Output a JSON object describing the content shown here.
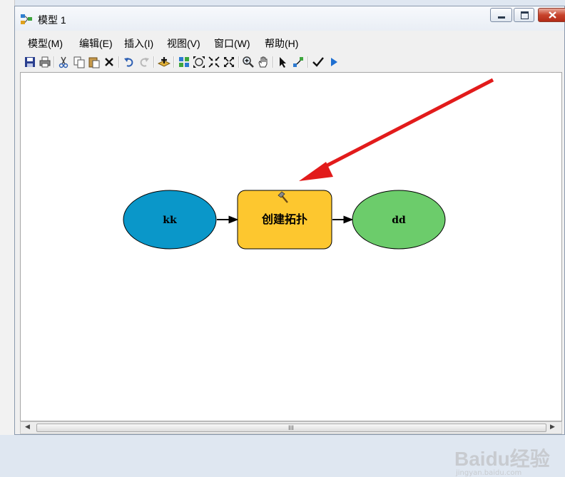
{
  "window": {
    "title": "模型 1"
  },
  "menu": [
    "模型(M)",
    "编辑(E)",
    "插入(I)",
    "视图(V)",
    "窗口(W)",
    "帮助(H)"
  ],
  "toolbar": {
    "buttons": [
      "save-icon",
      "print-icon",
      "cut-icon",
      "copy-icon",
      "paste-icon",
      "delete-icon",
      "undo-icon",
      "redo-icon",
      "add-data-icon",
      "auto-layout-icon",
      "full-extent-icon",
      "fixed-zoom-in-icon",
      "fixed-zoom-out-icon",
      "zoom-in-icon",
      "pan-icon",
      "select-icon",
      "connect-icon",
      "validate-icon",
      "run-icon"
    ]
  },
  "model": {
    "input_node": {
      "label": "kk",
      "color": "#0a97c9"
    },
    "tool_node": {
      "label": "创建拓扑",
      "color": "#fdc72f"
    },
    "output_node": {
      "label": "dd",
      "color": "#6ccc6b"
    }
  },
  "annotation": {
    "arrow_color": "#e21b1b"
  },
  "watermark": {
    "brand": "Baidu经验",
    "site": "jingyan.baidu.com"
  },
  "scrollbar": {
    "grip": "III"
  }
}
